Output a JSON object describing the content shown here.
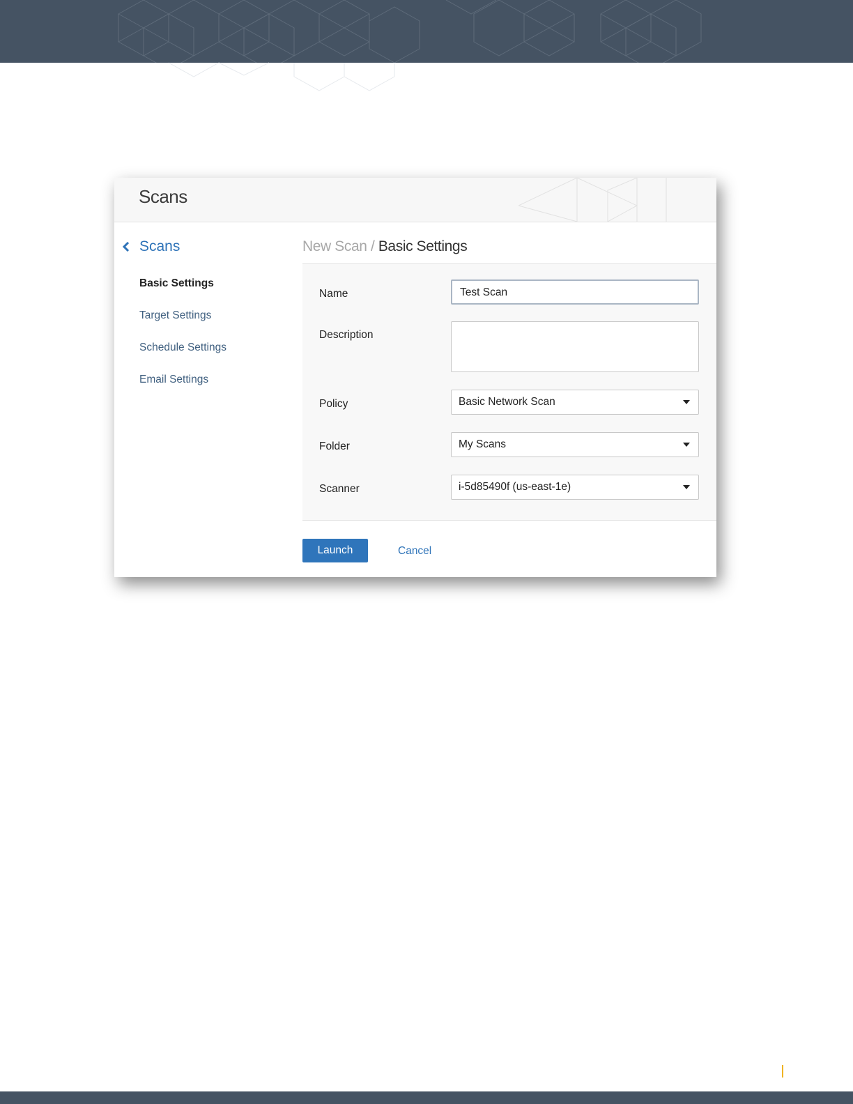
{
  "app": {
    "title": "Scans"
  },
  "sidebar": {
    "back_label": "Scans",
    "items": [
      {
        "label": "Basic Settings",
        "active": true
      },
      {
        "label": "Target Settings",
        "active": false
      },
      {
        "label": "Schedule Settings",
        "active": false
      },
      {
        "label": "Email Settings",
        "active": false
      }
    ]
  },
  "breadcrumb": {
    "parent": "New Scan",
    "separator": " / ",
    "current": "Basic Settings"
  },
  "form": {
    "name": {
      "label": "Name",
      "value": "Test Scan"
    },
    "description": {
      "label": "Description",
      "value": ""
    },
    "policy": {
      "label": "Policy",
      "value": "Basic Network Scan"
    },
    "folder": {
      "label": "Folder",
      "value": "My Scans"
    },
    "scanner": {
      "label": "Scanner",
      "value": "i-5d85490f (us-east-1e)"
    }
  },
  "actions": {
    "launch_label": "Launch",
    "cancel_label": "Cancel"
  },
  "colors": {
    "banner": "#455363",
    "accent": "#2f75bb",
    "page_marker": "#f0b323"
  }
}
